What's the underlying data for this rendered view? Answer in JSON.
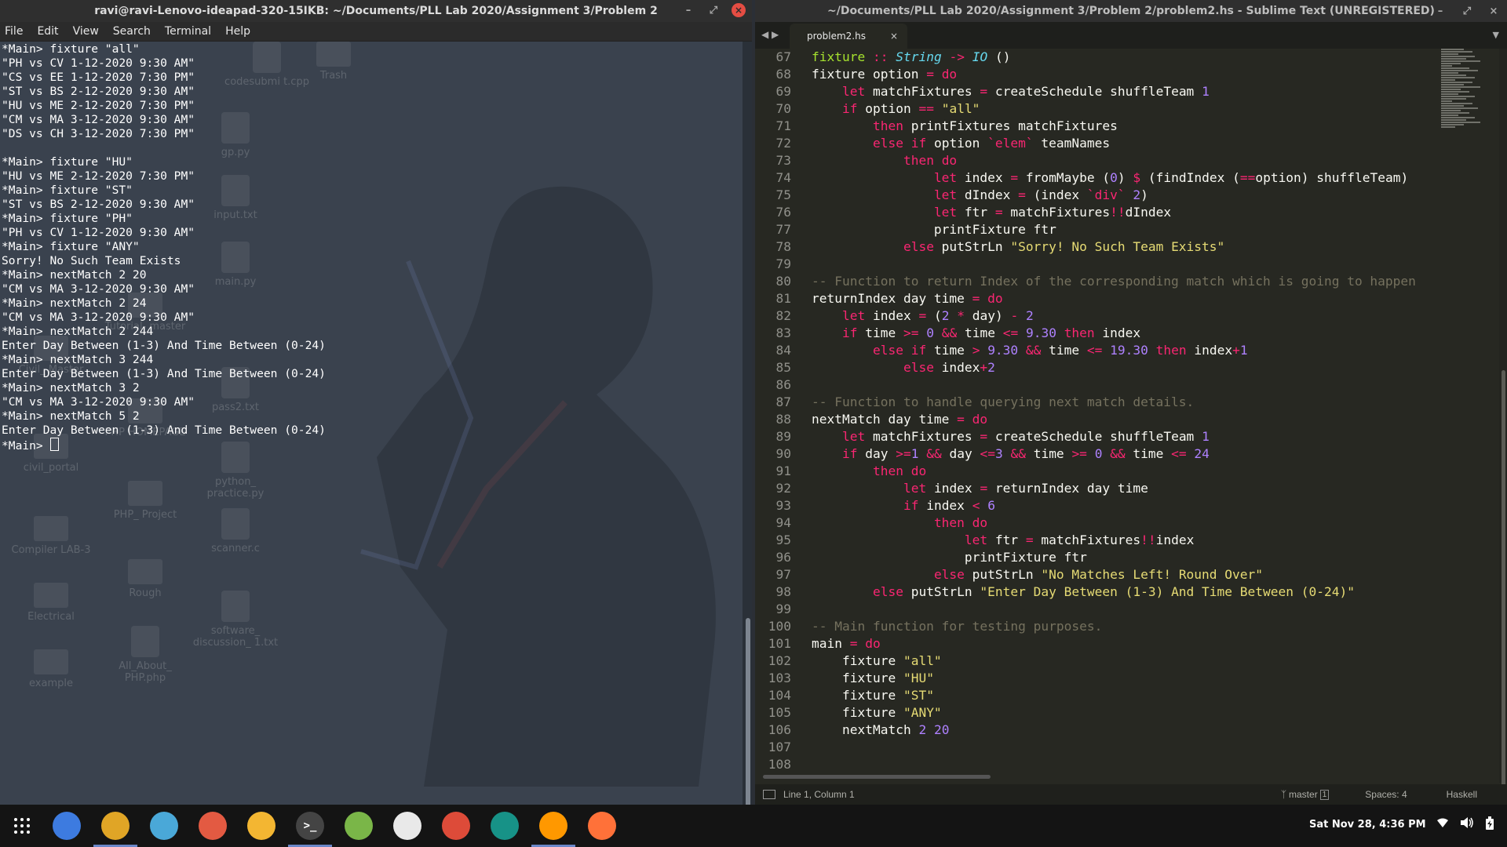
{
  "terminal": {
    "title": "ravi@ravi-Lenovo-ideapad-320-15IKB: ~/Documents/PLL Lab 2020/Assignment 3/Problem 2",
    "menu": [
      "File",
      "Edit",
      "View",
      "Search",
      "Terminal",
      "Help"
    ],
    "lines": [
      "*Main> fixture \"all\"",
      "\"PH vs CV 1-12-2020 9:30 AM\"",
      "\"CS vs EE 1-12-2020 7:30 PM\"",
      "\"ST vs BS 2-12-2020 9:30 AM\"",
      "\"HU vs ME 2-12-2020 7:30 PM\"",
      "\"CM vs MA 3-12-2020 9:30 AM\"",
      "\"DS vs CH 3-12-2020 7:30 PM\"",
      "",
      "*Main> fixture \"HU\"",
      "\"HU vs ME 2-12-2020 7:30 PM\"",
      "*Main> fixture \"ST\"",
      "\"ST vs BS 2-12-2020 9:30 AM\"",
      "*Main> fixture \"PH\"",
      "\"PH vs CV 1-12-2020 9:30 AM\"",
      "*Main> fixture \"ANY\"",
      "Sorry! No Such Team Exists",
      "*Main> nextMatch 2 20",
      "\"CM vs MA 3-12-2020 9:30 AM\"",
      "*Main> nextMatch 2 24",
      "\"CM vs MA 3-12-2020 9:30 AM\"",
      "*Main> nextMatch 2 244",
      "Enter Day Between (1-3) And Time Between (0-24)",
      "*Main> nextMatch 3 244",
      "Enter Day Between (1-3) And Time Between (0-24)",
      "*Main> nextMatch 3 2",
      "\"CM vs MA 3-12-2020 9:30 AM\"",
      "*Main> nextMatch 5 2",
      "Enter Day Between (1-3) And Time Between (0-24)"
    ],
    "prompt": "*Main> "
  },
  "desktop_icons": [
    {
      "label": "codesubmi t.cpp",
      "kind": "file"
    },
    {
      "label": "Trash",
      "kind": "folder"
    },
    {
      "label": "gp.py",
      "kind": "file"
    },
    {
      "label": "input.txt",
      "kind": "file"
    },
    {
      "label": "main.py",
      "kind": "file"
    },
    {
      "label": "Tutorial- master",
      "kind": "folder"
    },
    {
      "label": "Civil_ Master",
      "kind": "folder"
    },
    {
      "label": "pass2.txt",
      "kind": "file"
    },
    {
      "label": "PHP HOMEPAGE",
      "kind": "folder"
    },
    {
      "label": "civil_portal",
      "kind": "folder"
    },
    {
      "label": "python_ practice.py",
      "kind": "file"
    },
    {
      "label": "PHP_ Project",
      "kind": "folder"
    },
    {
      "label": "Compiler LAB-3",
      "kind": "folder"
    },
    {
      "label": "scanner.c",
      "kind": "file"
    },
    {
      "label": "Rough",
      "kind": "folder"
    },
    {
      "label": "Electrical",
      "kind": "folder"
    },
    {
      "label": "software_ discussion_ 1.txt",
      "kind": "file"
    },
    {
      "label": "All_About_ PHP.php",
      "kind": "file"
    },
    {
      "label": "example",
      "kind": "folder"
    }
  ],
  "editor": {
    "title": "~/Documents/PLL Lab 2020/Assignment 3/Problem 2/problem2.hs - Sublime Text (UNREGISTERED)",
    "tab_label": "problem2.hs",
    "first_line_number": 67,
    "status": {
      "position": "Line 1, Column 1",
      "branch": "master",
      "branch_count": "1",
      "spaces": "Spaces: 4",
      "syntax": "Haskell"
    }
  },
  "taskbar": {
    "apps": [
      {
        "name": "app-grid-icon",
        "color": "#ffffff"
      },
      {
        "name": "tasks-icon",
        "color": "#3d7be0"
      },
      {
        "name": "files-icon",
        "color": "#e0a526"
      },
      {
        "name": "settings-icon",
        "color": "#4aa8d8"
      },
      {
        "name": "software-icon",
        "color": "#e35a42"
      },
      {
        "name": "media-player-icon",
        "color": "#f3b632"
      },
      {
        "name": "terminal-icon",
        "color": "#444444"
      },
      {
        "name": "android-studio-icon",
        "color": "#7ab648"
      },
      {
        "name": "atom-icon",
        "color": "#e9e9e9"
      },
      {
        "name": "chrome-icon",
        "color": "#dd4b39"
      },
      {
        "name": "gitkraken-icon",
        "color": "#179287"
      },
      {
        "name": "sublime-text-icon",
        "color": "#ff9800"
      },
      {
        "name": "firefox-icon",
        "color": "#ff7139"
      }
    ],
    "clock": "Sat Nov 28,  4:36 PM"
  }
}
